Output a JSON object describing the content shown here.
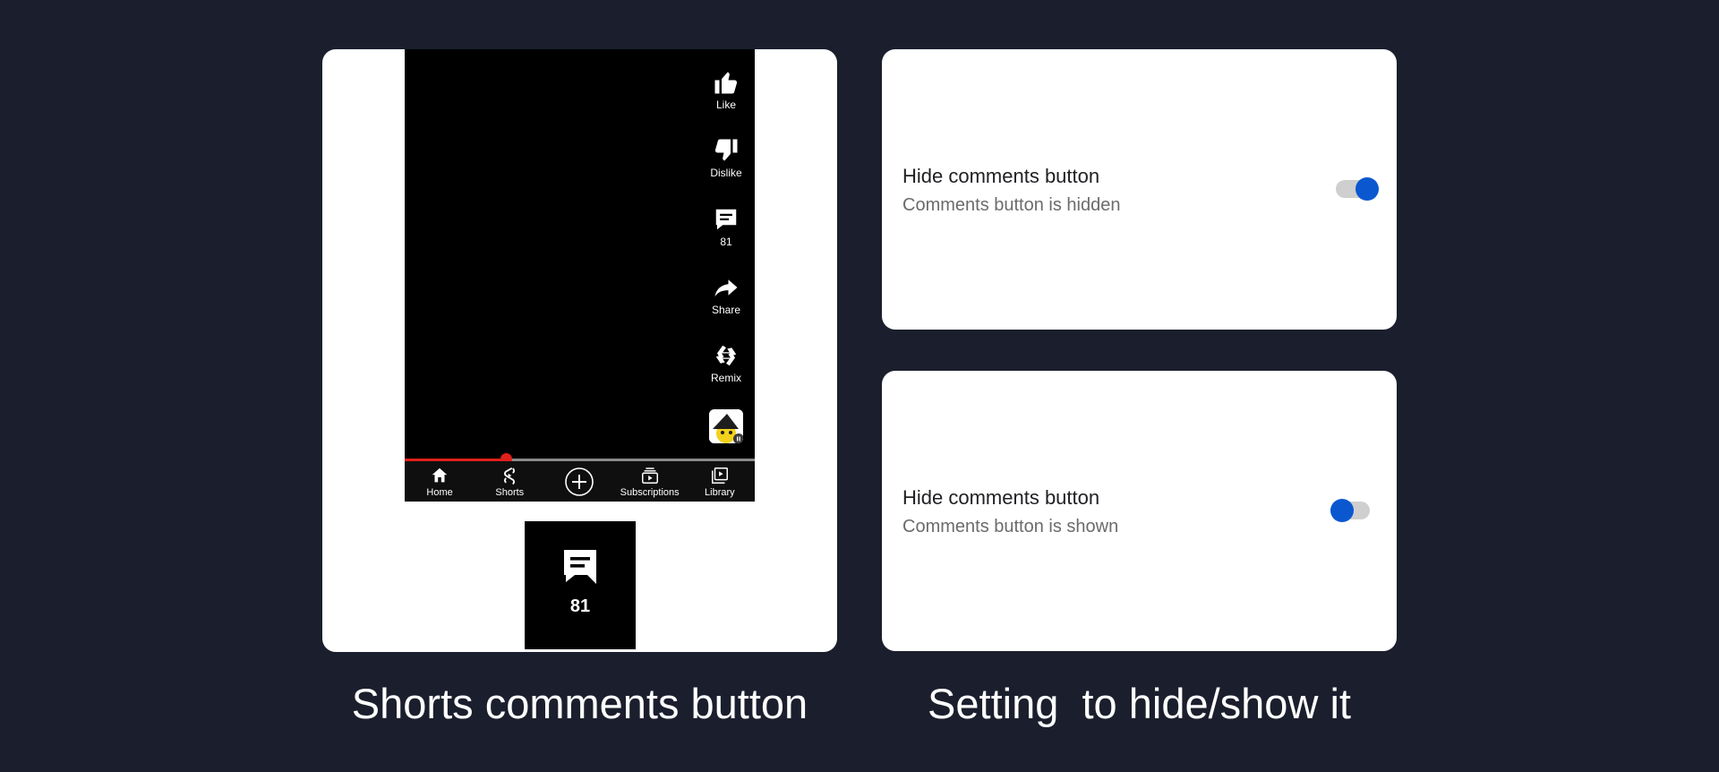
{
  "shorts_panel": {
    "actions": [
      {
        "name": "like",
        "label": "Like"
      },
      {
        "name": "dislike",
        "label": "Dislike"
      },
      {
        "name": "comments",
        "label": "81"
      },
      {
        "name": "share",
        "label": "Share"
      },
      {
        "name": "remix",
        "label": "Remix"
      }
    ],
    "progress": 0.29,
    "nav": [
      {
        "name": "home",
        "label": "Home",
        "icon": "home-icon"
      },
      {
        "name": "shorts",
        "label": "Shorts",
        "icon": "shorts-icon"
      },
      {
        "name": "create",
        "label": "",
        "icon": "plus-circle-icon"
      },
      {
        "name": "subscriptions",
        "label": "Subscriptions",
        "icon": "subscriptions-icon"
      },
      {
        "name": "library",
        "label": "Library",
        "icon": "library-icon"
      }
    ],
    "zoom_comment_count": "81",
    "colors": {
      "progress": "#e0201b",
      "background": "#000000"
    }
  },
  "settings": [
    {
      "title": "Hide comments button",
      "summary": "Comments button is hidden",
      "enabled": true
    },
    {
      "title": "Hide comments button",
      "summary": "Comments button is shown",
      "enabled": false
    }
  ],
  "accent_color": "#0b57d0",
  "captions": {
    "left": "Shorts comments button",
    "right": "Setting  to hide/show it"
  }
}
